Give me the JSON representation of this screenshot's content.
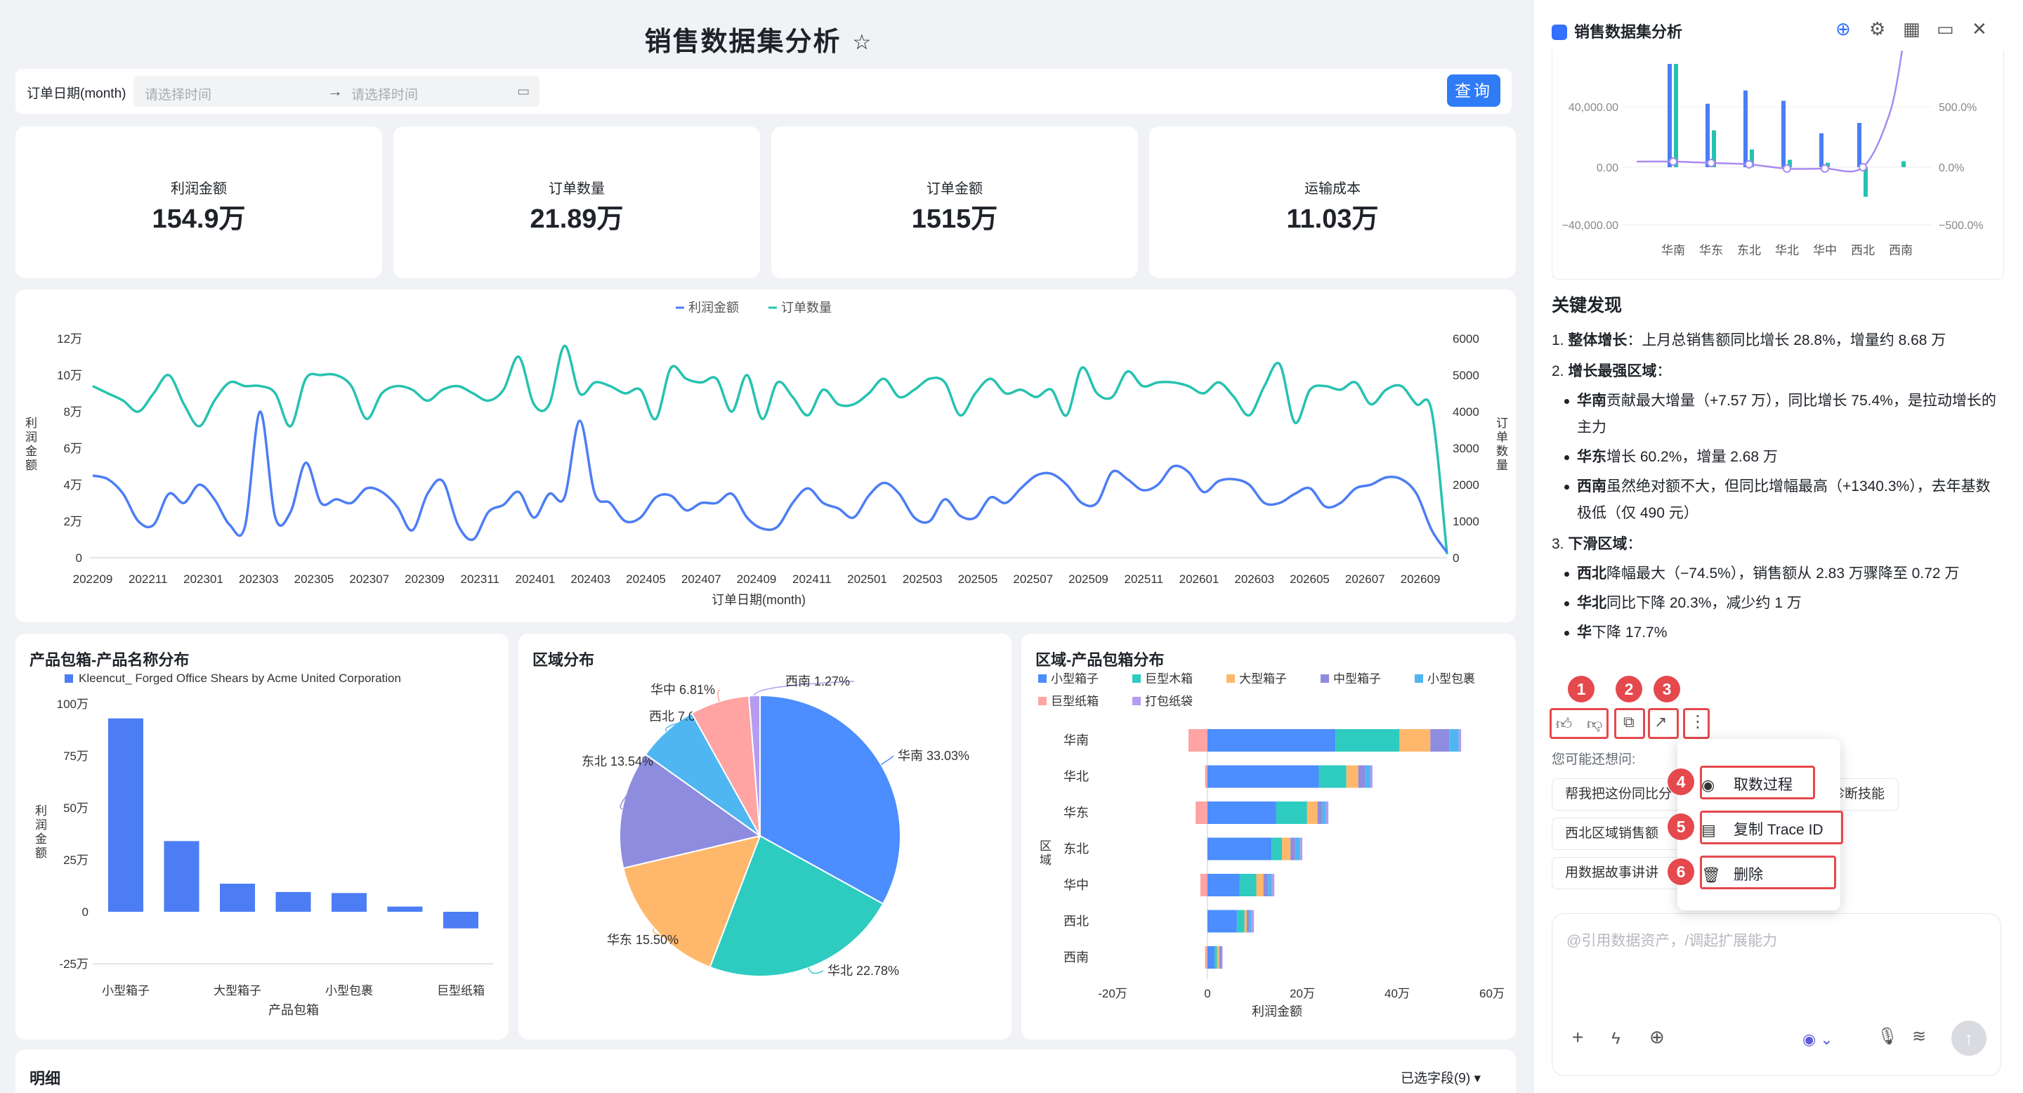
{
  "dashboard": {
    "title": "销售数据集分析",
    "star_icon": "star-icon",
    "filter": {
      "label": "订单日期(month)",
      "start_placeholder": "请选择时间",
      "end_placeholder": "请选择时间",
      "arrow": "→",
      "calendar_icon": "calendar-icon",
      "query_label": "查询"
    },
    "kpis": [
      {
        "label": "利润金额",
        "value": "154.9万"
      },
      {
        "label": "订单数量",
        "value": "21.89万"
      },
      {
        "label": "订单金额",
        "value": "1515万"
      },
      {
        "label": "运输成本",
        "value": "11.03万"
      }
    ],
    "detail": {
      "title": "明细",
      "fields_label": "已选字段(9)"
    }
  },
  "chart_data": [
    {
      "type": "line",
      "legend": [
        "利润金额",
        "订单数量"
      ],
      "xlabel": "订单日期(month)",
      "ylabel": "利润金额",
      "y2label": "订单数量",
      "colors": [
        "#4c7df5",
        "#26c2b0"
      ],
      "ylim": [
        0,
        120000
      ],
      "y2lim": [
        0,
        6000
      ],
      "yticks": [
        "0",
        "2万",
        "4万",
        "6万",
        "8万",
        "10万",
        "12万"
      ],
      "y2ticks": [
        "0",
        "1000",
        "2000",
        "3000",
        "4000",
        "5000",
        "6000"
      ],
      "xticks": [
        "202209",
        "202211",
        "202301",
        "202303",
        "202305",
        "202307",
        "202309",
        "202311",
        "202401",
        "202403",
        "202405",
        "202407",
        "202409",
        "202411",
        "202501",
        "202503",
        "202505",
        "202507",
        "202509",
        "202511",
        "202601",
        "202603",
        "202605",
        "202607",
        "202609"
      ],
      "series": [
        {
          "name": "利润金额",
          "values": [
            45000,
            43000,
            35000,
            20000,
            18000,
            35000,
            30000,
            40000,
            32000,
            18000,
            17000,
            80000,
            22000,
            25000,
            52000,
            30000,
            32000,
            30000,
            38000,
            36000,
            28000,
            15000,
            35000,
            42000,
            18000,
            10000,
            25000,
            29000,
            36000,
            22000,
            35000,
            33000,
            75000,
            35000,
            30000,
            20000,
            22000,
            33000,
            34000,
            26000,
            30000,
            30000,
            35000,
            22000,
            16000,
            17000,
            30000,
            38000,
            30000,
            27000,
            22000,
            34000,
            41000,
            35000,
            22000,
            20000,
            32000,
            23000,
            22000,
            33000,
            30000,
            38000,
            45000,
            46000,
            40000,
            30000,
            30000,
            47000,
            43000,
            37000,
            40000,
            50000,
            47000,
            36000,
            42000,
            43000,
            40000,
            30000,
            30000,
            35000,
            38000,
            28000,
            30000,
            38000,
            40000,
            44000,
            43000,
            35000,
            15000,
            3000
          ]
        },
        {
          "name": "订单数量",
          "values": [
            4700,
            4500,
            4300,
            4000,
            4500,
            5000,
            4200,
            3600,
            4300,
            4800,
            4700,
            4700,
            4500,
            3600,
            4900,
            5000,
            5000,
            4700,
            3800,
            4500,
            4700,
            4600,
            4300,
            4600,
            4700,
            4500,
            4300,
            4600,
            5500,
            4200,
            4200,
            5800,
            4500,
            4800,
            4700,
            4500,
            4600,
            3800,
            5200,
            4900,
            4800,
            4900,
            4000,
            5000,
            3800,
            4800,
            4400,
            3900,
            4600,
            4200,
            4200,
            4500,
            4900,
            4400,
            4600,
            4900,
            4800,
            3900,
            4500,
            4900,
            4500,
            4600,
            4400,
            4600,
            3900,
            5200,
            4500,
            4400,
            5100,
            4700,
            4800,
            4800,
            4700,
            4500,
            4800,
            4400,
            3900,
            4700,
            5300,
            3700,
            4600,
            4700,
            4600,
            4800,
            4200,
            4600,
            4700,
            4200,
            4000,
            100
          ]
        }
      ]
    },
    {
      "type": "bar",
      "title": "产品包箱-产品名称分布",
      "legend": [
        "Kleencut_ Forged Office Shears by Acme United Corporation"
      ],
      "xlabel": "产品包箱",
      "ylabel": "利润金额",
      "ylim": [
        -250000,
        1000000
      ],
      "yticks": [
        "-25万",
        "0",
        "25万",
        "50万",
        "75万",
        "100万"
      ],
      "categories": [
        "小型箱子",
        "",
        "大型箱子",
        "",
        "小型包裹",
        "",
        "巨型纸箱"
      ],
      "series": [
        {
          "name": "Kleencut_ Forged Office Shears by Acme United Corporation",
          "values": [
            930000,
            340000,
            135000,
            95000,
            90000,
            25000,
            -80000
          ]
        }
      ]
    },
    {
      "type": "pie",
      "title": "区域分布",
      "categories": [
        "华南",
        "华北",
        "华东",
        "东北",
        "西北",
        "华中",
        "西南"
      ],
      "labels": [
        "华南 33.03%",
        "华北 22.78%",
        "华东 15.50%",
        "东北 13.54%",
        "西北 7.07%",
        "华中 6.81%",
        "西南 1.27%"
      ],
      "values": [
        33.03,
        22.78,
        15.5,
        13.54,
        7.07,
        6.81,
        1.27
      ],
      "colors": [
        "#4c8dff",
        "#2ecbc0",
        "#ffb86b",
        "#8e8cde",
        "#4fb6f2",
        "#ffa3a3",
        "#b49cf0"
      ]
    },
    {
      "type": "bar",
      "orientation": "horizontal",
      "stacked": true,
      "title": "区域-产品包箱分布",
      "xlabel": "利润金额",
      "ylabel": "区域",
      "xlim": [
        -200000,
        600000
      ],
      "xticks": [
        "-20万",
        "0",
        "20万",
        "40万",
        "60万"
      ],
      "categories": [
        "华南",
        "华北",
        "华东",
        "东北",
        "华中",
        "西北",
        "西南"
      ],
      "legend": [
        "小型箱子",
        "巨型木箱",
        "大型箱子",
        "中型箱子",
        "小型包裹",
        "巨型纸箱",
        "打包纸袋"
      ],
      "colors": [
        "#4c8dff",
        "#2ecbc0",
        "#ffb86b",
        "#8e8cde",
        "#4fb6f2",
        "#ffa3a3",
        "#b49cf0"
      ],
      "series": [
        {
          "name": "小型箱子",
          "values": [
            270000,
            235000,
            145000,
            135000,
            68000,
            62000,
            15000
          ]
        },
        {
          "name": "巨型木箱",
          "values": [
            135000,
            58000,
            65000,
            22000,
            35000,
            16000,
            5000
          ]
        },
        {
          "name": "大型箱子",
          "values": [
            65000,
            25000,
            22000,
            18000,
            15000,
            5000,
            5000
          ]
        },
        {
          "name": "中型箱子",
          "values": [
            40000,
            15000,
            10000,
            10000,
            10000,
            5000,
            5000
          ]
        },
        {
          "name": "小型包裹",
          "values": [
            20000,
            10000,
            8000,
            10000,
            8000,
            5000,
            0
          ]
        },
        {
          "name": "巨型纸箱",
          "values": [
            -40000,
            -5000,
            -25000,
            0,
            -15000,
            0,
            -5000
          ]
        },
        {
          "name": "打包纸袋",
          "values": [
            5000,
            5000,
            5000,
            5000,
            5000,
            5000,
            2000
          ]
        }
      ]
    },
    {
      "type": "bar",
      "title": "",
      "categories": [
        "华南",
        "华东",
        "东北",
        "华北",
        "华中",
        "西北",
        "西南"
      ],
      "ylim": [
        -40000,
        40000
      ],
      "yticks": [
        "−40,000.00",
        "0.00",
        "40,000.00"
      ],
      "y2ticks": [
        "−500.0%",
        "0.0%",
        "500.0%"
      ],
      "series": [
        {
          "name": "",
          "values": [
            70000,
            43000,
            52000,
            45000,
            23000,
            30000,
            0
          ]
        },
        {
          "name": "",
          "values": [
            70000,
            25000,
            12000,
            5000,
            3000,
            -20000,
            4000
          ]
        }
      ]
    }
  ],
  "panel": {
    "title": "销售数据集分析",
    "header_icons": [
      "new-chat-icon",
      "settings-icon",
      "calendar-icon",
      "screen-icon",
      "close-icon"
    ],
    "findings_title": "关键发现",
    "items": [
      {
        "num": "1.",
        "bold": "整体增长",
        "text": "：上月总销售额同比增长 28.8%，增量约 8.68 万"
      },
      {
        "num": "2.",
        "bold": "增长最强区域",
        "text": "："
      },
      {
        "bullet": true,
        "bold": "华南",
        "text": "贡献最大增量（+7.57 万），同比增长 75.4%，是拉动增长的主力"
      },
      {
        "bullet": true,
        "bold": "华东",
        "text": "增长 60.2%，增量 2.68 万"
      },
      {
        "bullet": true,
        "bold": "西南",
        "text": "虽然绝对额不大，但同比增幅最高（+1340.3%），去年基数极低（仅 490 元）"
      },
      {
        "num": "3.",
        "bold": "下滑区域",
        "text": "："
      },
      {
        "bullet": true,
        "bold": "西北",
        "text": "降幅最大（−74.5%），销售额从 2.83 万骤降至 0.72 万"
      },
      {
        "bullet": true,
        "bold": "华北",
        "text": "同比下降 20.3%，减少约 1 万"
      },
      {
        "bullet": true,
        "bold": "华",
        "text": "下降 17.7%"
      }
    ],
    "badges": [
      "1",
      "2",
      "3",
      "4",
      "5",
      "6"
    ],
    "menu": [
      {
        "label": "取数过程",
        "icon": "eye-icon"
      },
      {
        "label": "复制 Trace ID",
        "icon": "document-icon"
      },
      {
        "label": "删除",
        "icon": "trash-icon"
      }
    ],
    "suggest_title": "您可能还想问:",
    "suggestions": [
      "帮我把这份同比分",
      "诊断技能",
      "西北区域销售额",
      "用数据故事讲讲"
    ],
    "input_placeholder": "@引用数据资产，/调起扩展能力",
    "input_icons": [
      "plus-icon",
      "lightning-icon",
      "globe-icon",
      "model-icon",
      "mic-icon",
      "voice-icon",
      "send-icon"
    ]
  }
}
